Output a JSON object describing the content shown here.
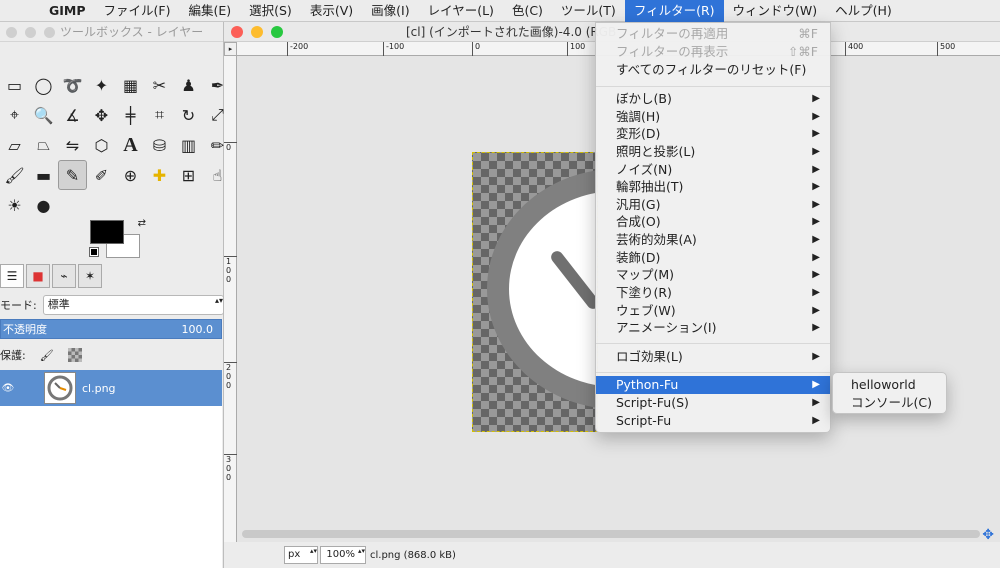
{
  "menubar": {
    "apple": "",
    "items": [
      "GIMP",
      "ファイル(F)",
      "編集(E)",
      "選択(S)",
      "表示(V)",
      "画像(I)",
      "レイヤー(L)",
      "色(C)",
      "ツール(T)",
      "フィルター(R)",
      "ウィンドウ(W)",
      "ヘルプ(H)"
    ],
    "active_item": "フィルター(R)"
  },
  "toolbox": {
    "title": "ツールボックス - レイヤー",
    "tool_icons": [
      "rect-select-icon",
      "ellipse-select-icon",
      "lasso-icon",
      "magic-wand-icon",
      "select-by-color-icon",
      "scissors-icon",
      "foreground-select-icon",
      "paths-icon",
      "color-picker-icon",
      "zoom-icon",
      "measure-icon",
      "move-icon",
      "align-icon",
      "crop-icon",
      "rotate-icon",
      "scale-icon",
      "shear-icon",
      "perspective-icon",
      "flip-icon",
      "cage-icon",
      "text-icon",
      "bucket-fill-icon",
      "blend-icon",
      "pencil-icon",
      "paintbrush-icon",
      "eraser-icon",
      "airbrush-icon",
      "ink-icon",
      "clone-icon",
      "heal-icon",
      "perspective-clone-icon",
      "smudge-icon",
      "dodge-burn-icon",
      "blur-icon"
    ],
    "selected_tool": "airbrush-icon",
    "foreground_color": "#000000",
    "background_color": "#ffffff",
    "mode_label": "モード:",
    "mode_value": "標準",
    "opacity_label": "不透明度",
    "opacity_value": "100.0",
    "lock_label": "保護:",
    "layer_name": "cl.png"
  },
  "image_window": {
    "title": "[cl] (インポートされた画像)-4.0 (RGB",
    "ruler_h_ticks": [
      "-200",
      "-100",
      "0",
      "100",
      "400",
      "500"
    ],
    "ruler_v_ticks": [
      "0",
      "1\n0\n0",
      "2\n0\n0",
      "3\n0\n0"
    ],
    "unit": "px",
    "zoom": "100%",
    "status_file": "cl.png (868.0 kB)"
  },
  "filters_menu": {
    "top": [
      {
        "label": "フィルターの再適用",
        "shortcut": "⌘F",
        "disabled": true
      },
      {
        "label": "フィルターの再表示",
        "shortcut": "⇧⌘F",
        "disabled": true
      },
      {
        "label": "すべてのフィルターのリセット(F)",
        "shortcut": "",
        "disabled": false
      }
    ],
    "groups": [
      "ぼかし(B)",
      "強調(H)",
      "変形(D)",
      "照明と投影(L)",
      "ノイズ(N)",
      "輪郭抽出(T)",
      "汎用(G)",
      "合成(O)",
      "芸術的効果(A)",
      "装飾(D)",
      "マップ(M)",
      "下塗り(R)",
      "ウェブ(W)",
      "アニメーション(I)"
    ],
    "logo": "ロゴ効果(L)",
    "scripts": [
      "Python-Fu",
      "Script-Fu(S)",
      "Script-Fu"
    ],
    "highlighted": "Python-Fu"
  },
  "python_fu_submenu": [
    "helloworld",
    "コンソール(C)"
  ],
  "colors": {
    "accent": "#2f73d8",
    "layer_selected": "#5b8fd0",
    "close": "#fc5f57",
    "minimize": "#fdbc2e",
    "zoom": "#28c840"
  }
}
